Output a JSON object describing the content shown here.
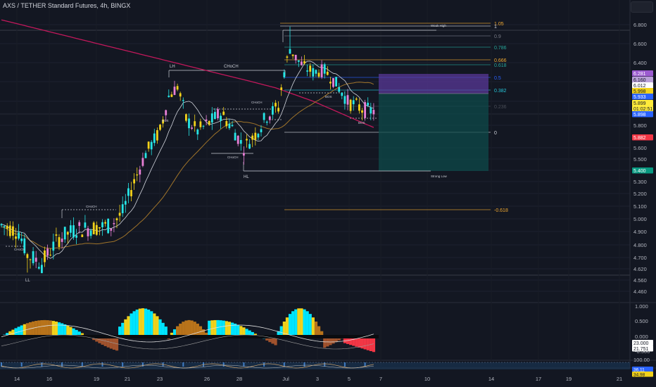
{
  "header": {
    "title": "AXS / TETHER Standard Futures, 4h, BINGX"
  },
  "chart_data": {
    "type": "candlestick",
    "title": "AXS / TETHER Standard Futures, 4h, BINGX",
    "price_axis": {
      "ylim": [
        4.4,
        6.9
      ],
      "ticks": [
        "6.800",
        "6.600",
        "6.400",
        "6.200",
        "6.000",
        "5.800",
        "5.600",
        "5.500",
        "5.400",
        "5.300",
        "5.200",
        "5.100",
        "5.000",
        "4.900",
        "4.800",
        "4.700",
        "4.620",
        "4.560",
        "4.460"
      ]
    },
    "time_axis": {
      "ticks": [
        "14",
        "16",
        "19",
        "21",
        "23",
        "26",
        "28",
        "Jul",
        "3",
        "5",
        "7",
        "10",
        "14",
        "17",
        "19",
        "21"
      ]
    },
    "price_labels": [
      {
        "text": "6.281",
        "color": "#9c5bd0",
        "text_color": "#ffffff"
      },
      {
        "text": "6.160",
        "color": "#b9a0d8",
        "text_color": "#131722"
      },
      {
        "text": "6.012",
        "color": "#ffffff",
        "text_color": "#131722"
      },
      {
        "text": "5.998",
        "color": "#f2d21a",
        "text_color": "#131722"
      },
      {
        "text": "5.933",
        "color": "#2962ff",
        "text_color": "#ffffff"
      },
      {
        "text": "5.899",
        "color": "#ffeb3b",
        "text_color": "#131722"
      },
      {
        "text": "01:02:51",
        "color": "#ffeb3b",
        "text_color": "#131722"
      },
      {
        "text": "5.898",
        "color": "#2962ff",
        "text_color": "#ffffff"
      },
      {
        "text": "5.882",
        "color": "#f23645",
        "text_color": "#ffffff"
      },
      {
        "text": "5.400",
        "color": "#089981",
        "text_color": "#ffffff"
      }
    ],
    "fibonacci": [
      {
        "level": "1.05",
        "color": "#f0a830"
      },
      {
        "level": "1",
        "color": "#d1d4dc"
      },
      {
        "level": "0.9",
        "color": "#787b86"
      },
      {
        "level": "0.786",
        "color": "#26a69a"
      },
      {
        "level": "0.666",
        "color": "#f0a830"
      },
      {
        "level": "0.618",
        "color": "#26a69a"
      },
      {
        "level": "0.5",
        "color": "#2962ff"
      },
      {
        "level": "0.382",
        "color": "#26c6da"
      },
      {
        "level": "0.236",
        "color": "#4a4e58"
      },
      {
        "level": "0",
        "color": "#d1d4dc"
      },
      {
        "level": "-0.618",
        "color": "#f0a830"
      }
    ],
    "annotations": [
      "LH",
      "CHoCH",
      "HL",
      "LL",
      "Weak High",
      "Strong Low",
      "BOS",
      "CHoCH",
      "CHoCH",
      "CHoCH",
      "BOS",
      "BOS",
      "CHoCH"
    ],
    "oscillator_1": {
      "ticks": [
        "1.000",
        "0.500",
        "0.000",
        "-0.500"
      ],
      "values": [
        "23.000",
        "21.751"
      ]
    },
    "oscillator_2": {
      "ticks": [
        "100.00"
      ],
      "values": [
        "36.11",
        "34.98"
      ]
    },
    "colors": {
      "up": "#26e6e6",
      "down": "#f2d21a",
      "alt_up": "#e87fd6",
      "ema_long": "#c2185b",
      "ema_mid": "#a0742a",
      "ema_short": "#d1d4dc",
      "bg": "#131722"
    }
  }
}
